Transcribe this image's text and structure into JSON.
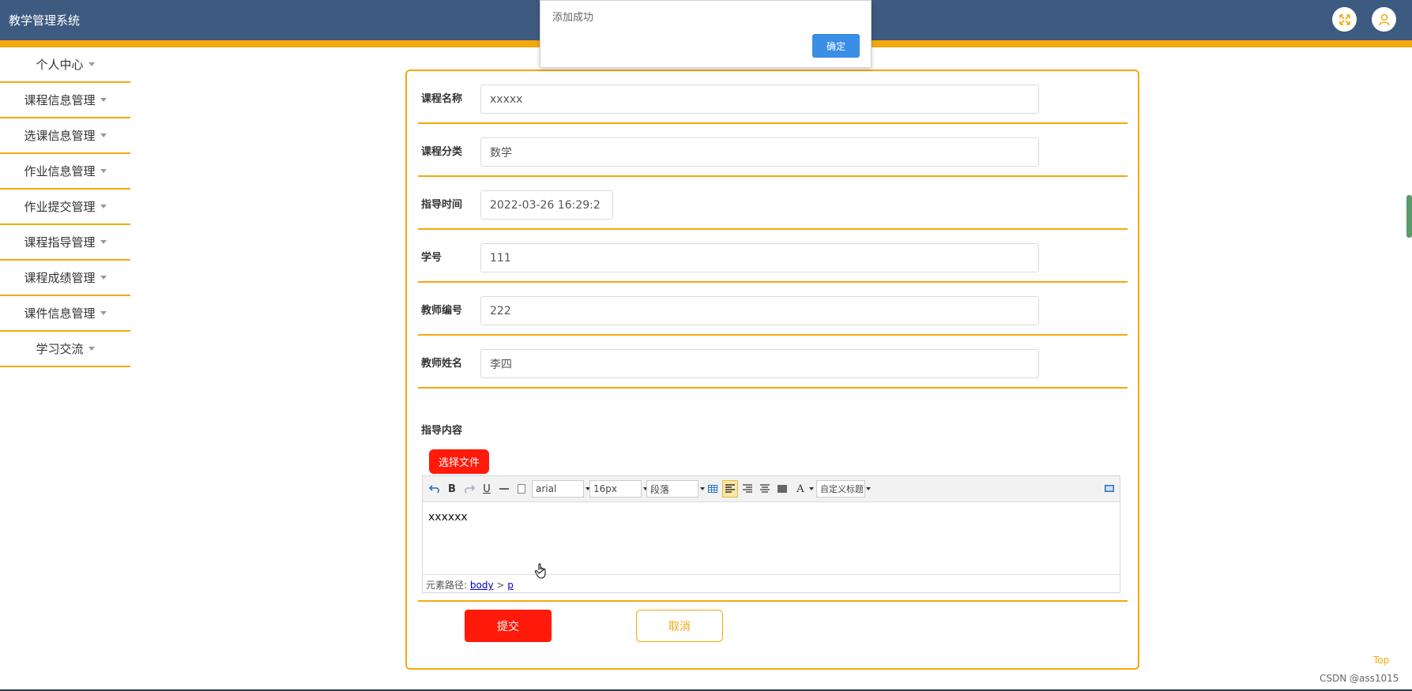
{
  "header": {
    "title": "教学管理系统",
    "expand_icon": "expand-icon",
    "user_icon": "user-icon"
  },
  "dialog": {
    "message": "添加成功",
    "ok_label": "确定"
  },
  "sidebar": {
    "items": [
      {
        "label": "个人中心"
      },
      {
        "label": "课程信息管理"
      },
      {
        "label": "选课信息管理"
      },
      {
        "label": "作业信息管理"
      },
      {
        "label": "作业提交管理"
      },
      {
        "label": "课程指导管理"
      },
      {
        "label": "课程成绩管理"
      },
      {
        "label": "课件信息管理"
      },
      {
        "label": "学习交流"
      }
    ]
  },
  "form": {
    "course_name": {
      "label": "课程名称",
      "value": "xxxxx"
    },
    "course_category": {
      "label": "课程分类",
      "value": "数学"
    },
    "guide_time": {
      "label": "指导时间",
      "value": "2022-03-26 16:29:2"
    },
    "student_no": {
      "label": "学号",
      "value": "111"
    },
    "teacher_no": {
      "label": "教师编号",
      "value": "222"
    },
    "teacher_name": {
      "label": "教师姓名",
      "value": "李四"
    },
    "guide_content": {
      "label": "指导内容",
      "choose_file_label": "选择文件"
    },
    "submit_label": "提交",
    "cancel_label": "取消"
  },
  "editor": {
    "font_family": "arial",
    "font_size": "16px",
    "paragraph": "段落",
    "custom_heading": "自定义标题",
    "bold_glyph": "B",
    "underline_glyph": "U",
    "font_color_glyph": "A",
    "content": "xxxxxx",
    "path_label": "元素路径:",
    "path_body": "body",
    "path_sep": ">",
    "path_p": "p"
  },
  "footer": {
    "top_link": "Top",
    "watermark": "CSDN @ass1015"
  },
  "colors": {
    "header_bg": "#3d5a80",
    "accent": "#f5a80b",
    "primary_red": "#ff1a0a",
    "dialog_blue": "#3a8ee6"
  }
}
